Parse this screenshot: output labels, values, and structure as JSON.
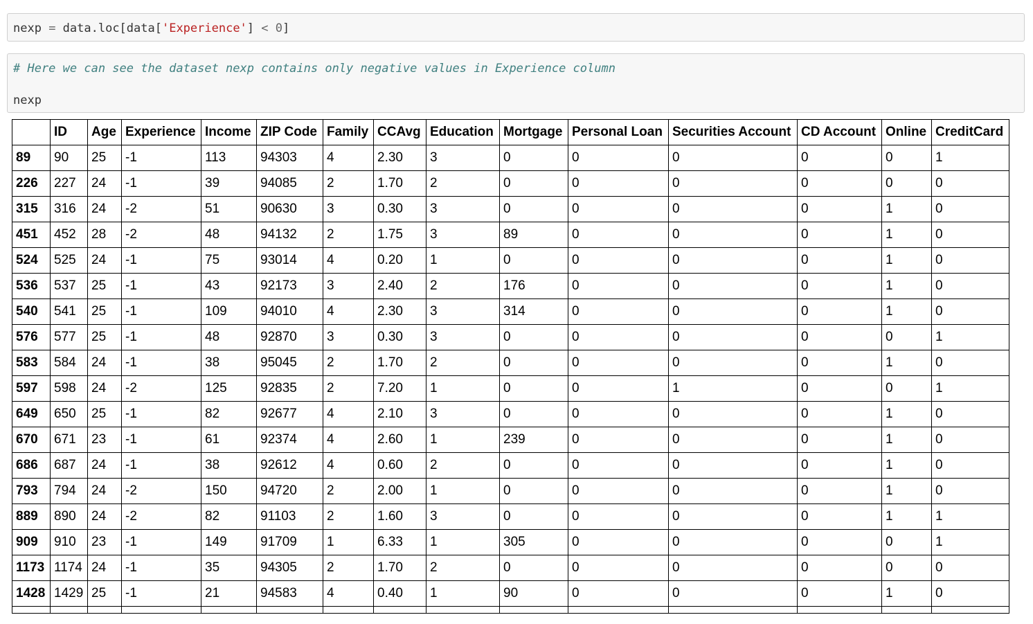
{
  "cell1": {
    "code": {
      "var": "nexp",
      "assign": " = ",
      "obj": "data.loc[data[",
      "key": "'Experience'",
      "cond_open": "] ",
      "cmp": "<",
      "sp": " ",
      "num": "0",
      "close": "]"
    }
  },
  "cell2": {
    "comment": "# Here we can see the dataset nexp contains only negative values in Experience column",
    "expr": "nexp"
  },
  "table": {
    "columns": [
      "",
      "ID",
      "Age",
      "Experience",
      "Income",
      "ZIP Code",
      "Family",
      "CCAvg",
      "Education",
      "Mortgage",
      "Personal Loan",
      "Securities Account",
      "CD Account",
      "Online",
      "CreditCard"
    ],
    "rows": [
      {
        "index": "89",
        "cells": [
          "90",
          "25",
          "-1",
          "113",
          "94303",
          "4",
          "2.30",
          "3",
          "0",
          "0",
          "0",
          "0",
          "0",
          "1"
        ]
      },
      {
        "index": "226",
        "cells": [
          "227",
          "24",
          "-1",
          "39",
          "94085",
          "2",
          "1.70",
          "2",
          "0",
          "0",
          "0",
          "0",
          "0",
          "0"
        ]
      },
      {
        "index": "315",
        "cells": [
          "316",
          "24",
          "-2",
          "51",
          "90630",
          "3",
          "0.30",
          "3",
          "0",
          "0",
          "0",
          "0",
          "1",
          "0"
        ]
      },
      {
        "index": "451",
        "cells": [
          "452",
          "28",
          "-2",
          "48",
          "94132",
          "2",
          "1.75",
          "3",
          "89",
          "0",
          "0",
          "0",
          "1",
          "0"
        ]
      },
      {
        "index": "524",
        "cells": [
          "525",
          "24",
          "-1",
          "75",
          "93014",
          "4",
          "0.20",
          "1",
          "0",
          "0",
          "0",
          "0",
          "1",
          "0"
        ]
      },
      {
        "index": "536",
        "cells": [
          "537",
          "25",
          "-1",
          "43",
          "92173",
          "3",
          "2.40",
          "2",
          "176",
          "0",
          "0",
          "0",
          "1",
          "0"
        ]
      },
      {
        "index": "540",
        "cells": [
          "541",
          "25",
          "-1",
          "109",
          "94010",
          "4",
          "2.30",
          "3",
          "314",
          "0",
          "0",
          "0",
          "1",
          "0"
        ]
      },
      {
        "index": "576",
        "cells": [
          "577",
          "25",
          "-1",
          "48",
          "92870",
          "3",
          "0.30",
          "3",
          "0",
          "0",
          "0",
          "0",
          "0",
          "1"
        ]
      },
      {
        "index": "583",
        "cells": [
          "584",
          "24",
          "-1",
          "38",
          "95045",
          "2",
          "1.70",
          "2",
          "0",
          "0",
          "0",
          "0",
          "1",
          "0"
        ]
      },
      {
        "index": "597",
        "cells": [
          "598",
          "24",
          "-2",
          "125",
          "92835",
          "2",
          "7.20",
          "1",
          "0",
          "0",
          "1",
          "0",
          "0",
          "1"
        ]
      },
      {
        "index": "649",
        "cells": [
          "650",
          "25",
          "-1",
          "82",
          "92677",
          "4",
          "2.10",
          "3",
          "0",
          "0",
          "0",
          "0",
          "1",
          "0"
        ]
      },
      {
        "index": "670",
        "cells": [
          "671",
          "23",
          "-1",
          "61",
          "92374",
          "4",
          "2.60",
          "1",
          "239",
          "0",
          "0",
          "0",
          "1",
          "0"
        ]
      },
      {
        "index": "686",
        "cells": [
          "687",
          "24",
          "-1",
          "38",
          "92612",
          "4",
          "0.60",
          "2",
          "0",
          "0",
          "0",
          "0",
          "1",
          "0"
        ]
      },
      {
        "index": "793",
        "cells": [
          "794",
          "24",
          "-2",
          "150",
          "94720",
          "2",
          "2.00",
          "1",
          "0",
          "0",
          "0",
          "0",
          "1",
          "0"
        ]
      },
      {
        "index": "889",
        "cells": [
          "890",
          "24",
          "-2",
          "82",
          "91103",
          "2",
          "1.60",
          "3",
          "0",
          "0",
          "0",
          "0",
          "1",
          "1"
        ]
      },
      {
        "index": "909",
        "cells": [
          "910",
          "23",
          "-1",
          "149",
          "91709",
          "1",
          "6.33",
          "1",
          "305",
          "0",
          "0",
          "0",
          "0",
          "1"
        ]
      },
      {
        "index": "1173",
        "cells": [
          "1174",
          "24",
          "-1",
          "35",
          "94305",
          "2",
          "1.70",
          "2",
          "0",
          "0",
          "0",
          "0",
          "0",
          "0"
        ]
      },
      {
        "index": "1428",
        "cells": [
          "1429",
          "25",
          "-1",
          "21",
          "94583",
          "4",
          "0.40",
          "1",
          "90",
          "0",
          "0",
          "0",
          "1",
          "0"
        ]
      }
    ]
  }
}
